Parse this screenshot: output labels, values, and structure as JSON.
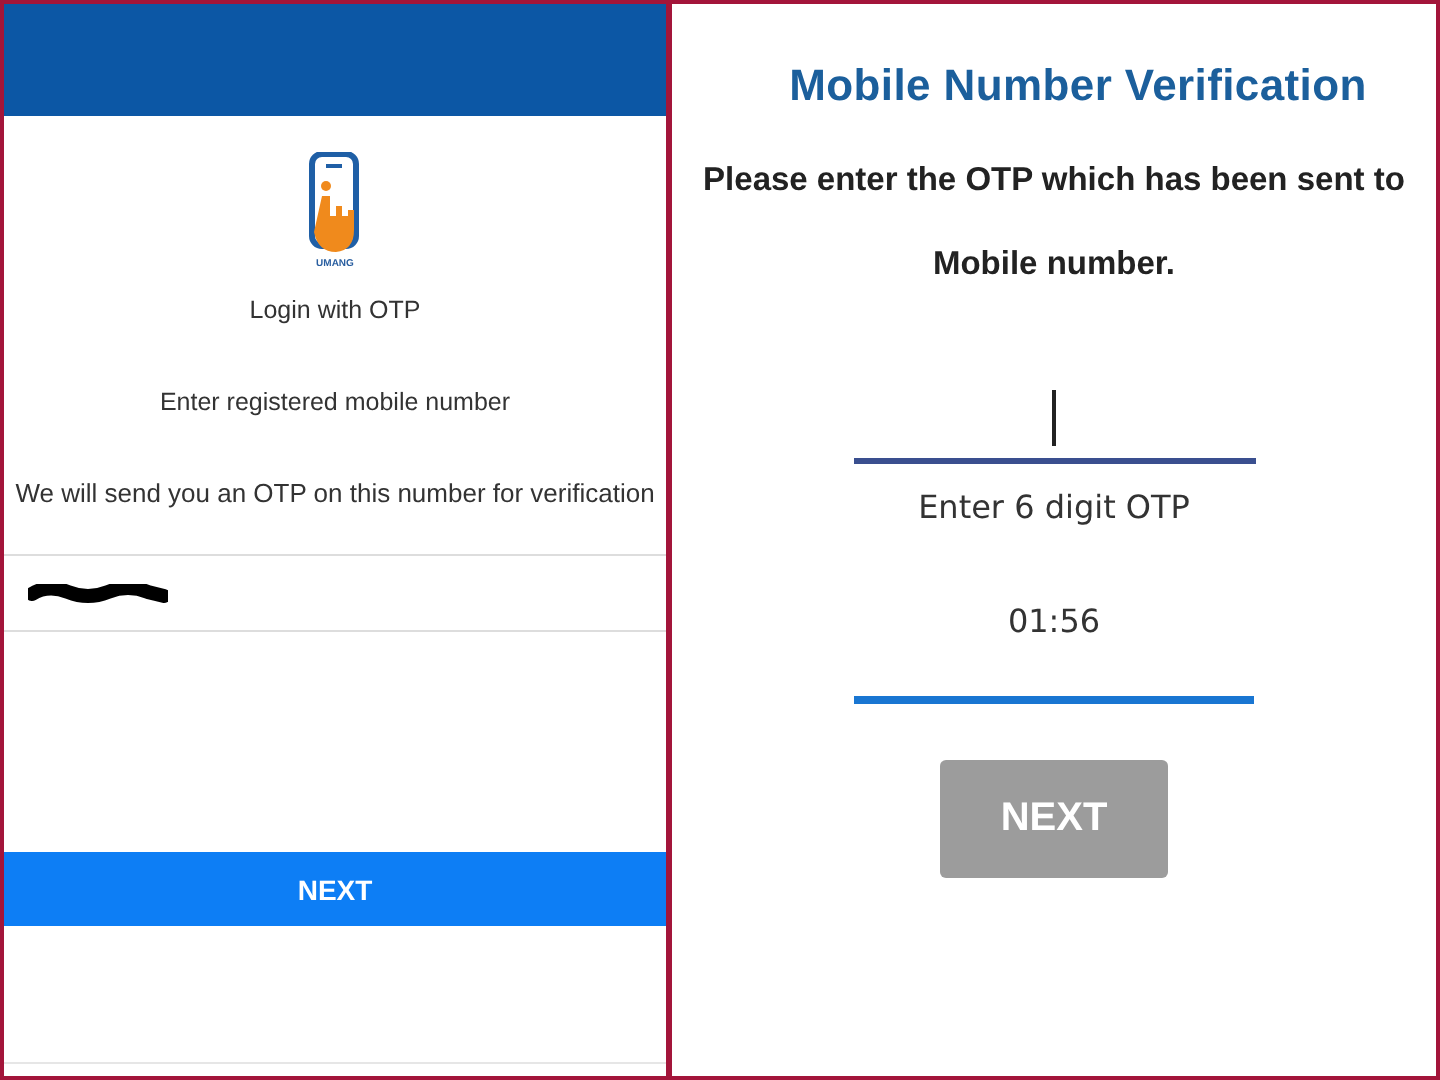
{
  "login_screen": {
    "logo_caption": "UMANG",
    "heading": "Login with OTP",
    "prompt": "Enter registered mobile number",
    "note": "We will send you an OTP on this number for verification",
    "mobile_field": {
      "redacted": true
    },
    "next_button": {
      "label": "NEXT",
      "disabled": false
    }
  },
  "verification_screen": {
    "title": "Mobile Number Verification",
    "message_lines": [
      "Please enter the OTP which has been sent to",
      "Mobile number."
    ],
    "otp_field": {
      "focused": true,
      "label": "Enter 6 digit OTP"
    },
    "timer": {
      "text": "01:56",
      "level": 1
    },
    "next_button": {
      "label": "NEXT",
      "disabled": true
    }
  }
}
